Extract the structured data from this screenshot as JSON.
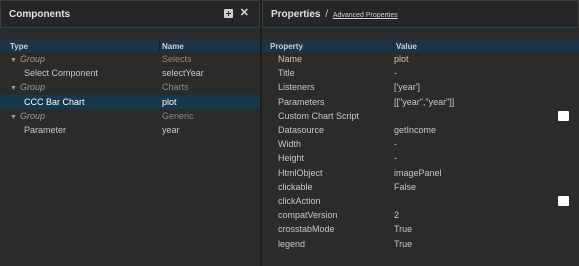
{
  "components_panel": {
    "title": "Components",
    "columns": {
      "type": "Type",
      "name": "Name"
    },
    "rows": [
      {
        "type": "Group",
        "name": "Selects",
        "is_group": true
      },
      {
        "type": "Select Component",
        "name": "selectYear",
        "is_group": false
      },
      {
        "type": "Group",
        "name": "Charts",
        "is_group": true
      },
      {
        "type": "CCC Bar Chart",
        "name": "plot",
        "is_group": false,
        "selected": true
      },
      {
        "type": "Group",
        "name": "Generic",
        "is_group": true
      },
      {
        "type": "Parameter",
        "name": "year",
        "is_group": false
      }
    ]
  },
  "properties_panel": {
    "title": "Properties",
    "separator": "/",
    "advanced_link": "Advanced Properties",
    "columns": {
      "property": "Property",
      "value": "Value"
    },
    "rows": [
      {
        "property": "Name",
        "value": "plot"
      },
      {
        "property": "Title",
        "value": "-"
      },
      {
        "property": "Listeners",
        "value": "['year']"
      },
      {
        "property": "Parameters",
        "value": "[[\"year\",\"year\"]]"
      },
      {
        "property": "Custom Chart Script",
        "value": "",
        "checkbox": true
      },
      {
        "property": "Datasource",
        "value": "getIncome"
      },
      {
        "property": "Width",
        "value": "-"
      },
      {
        "property": "Height",
        "value": "-"
      },
      {
        "property": "HtmlObject",
        "value": "imagePanel"
      },
      {
        "property": "clickable",
        "value": "False"
      },
      {
        "property": "clickAction",
        "value": "",
        "checkbox": true
      },
      {
        "property": "compatVersion",
        "value": "2"
      },
      {
        "property": "crosstabMode",
        "value": "True"
      },
      {
        "property": "legend",
        "value": "True"
      }
    ]
  },
  "colors": {
    "background": "#2b2b2b",
    "column_header": "#1a3448",
    "selected_row": "#16384c",
    "header_rule": "#0f4660"
  },
  "icons": {
    "add": "add-icon",
    "delete": "close-icon",
    "expand": "triangle-down-icon"
  }
}
